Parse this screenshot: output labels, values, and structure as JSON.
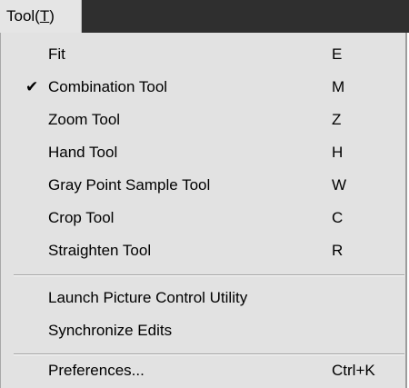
{
  "menubar": {
    "title_prefix": "Tool(",
    "title_mnemonic": "T",
    "title_suffix": ")"
  },
  "menu": {
    "items": [
      {
        "label": "Fit",
        "shortcut": "E",
        "checked": false
      },
      {
        "label": "Combination Tool",
        "shortcut": "M",
        "checked": true,
        "check_mark": "✔"
      },
      {
        "label": "Zoom Tool",
        "shortcut": "Z",
        "checked": false
      },
      {
        "label": "Hand Tool",
        "shortcut": "H",
        "checked": false
      },
      {
        "label": "Gray Point Sample Tool",
        "shortcut": "W",
        "checked": false
      },
      {
        "label": "Crop Tool",
        "shortcut": "C",
        "checked": false
      },
      {
        "label": "Straighten Tool",
        "shortcut": "R",
        "checked": false
      },
      {
        "label": "Launch Picture Control Utility",
        "shortcut": "",
        "checked": false
      },
      {
        "label": "Synchronize Edits",
        "shortcut": "",
        "checked": false
      },
      {
        "label": "Preferences...",
        "shortcut": "Ctrl+K",
        "checked": false
      }
    ]
  }
}
